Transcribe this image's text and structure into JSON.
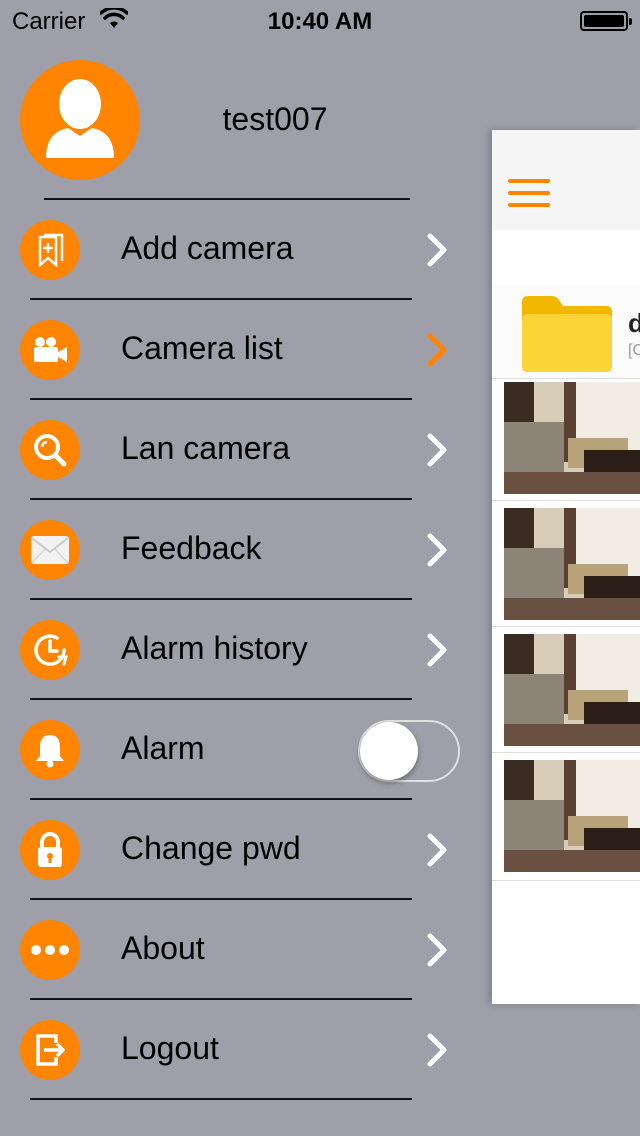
{
  "status_bar": {
    "carrier": "Carrier",
    "time": "10:40 AM"
  },
  "profile": {
    "username": "test007"
  },
  "menu": [
    {
      "label": "Add camera",
      "icon": "bookmark-add-icon",
      "chevron_color": "#ffffff"
    },
    {
      "label": "Camera list",
      "icon": "video-camera-icon",
      "chevron_color": "#ff8400"
    },
    {
      "label": "Lan camera",
      "icon": "search-icon",
      "chevron_color": "#ffffff"
    },
    {
      "label": "Feedback",
      "icon": "envelope-icon",
      "chevron_color": "#ffffff"
    },
    {
      "label": "Alarm history",
      "icon": "clock-history-icon",
      "chevron_color": "#ffffff"
    },
    {
      "label": "Alarm",
      "icon": "bell-icon",
      "toggle": false
    },
    {
      "label": "Change pwd",
      "icon": "lock-icon",
      "chevron_color": "#ffffff"
    },
    {
      "label": "About",
      "icon": "more-dots-icon",
      "chevron_color": "#ffffff"
    },
    {
      "label": "Logout",
      "icon": "logout-icon",
      "chevron_color": "#ffffff"
    }
  ],
  "background_panel": {
    "folder_title": "d",
    "folder_subtitle": "[C"
  },
  "colors": {
    "accent": "#ff8400",
    "drawer_bg": "#9f9faa"
  }
}
